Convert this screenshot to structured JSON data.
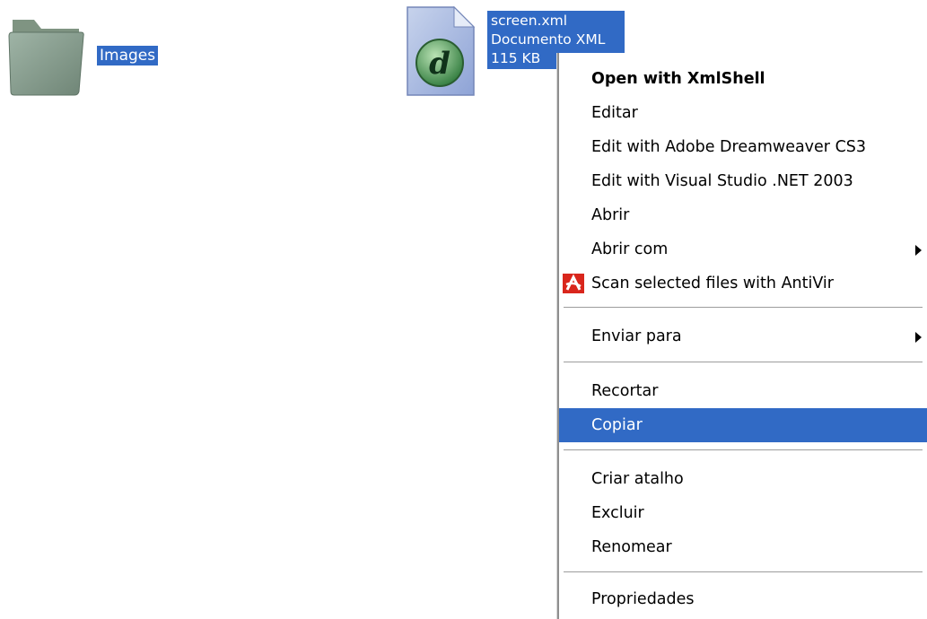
{
  "folder": {
    "name": "Images",
    "icon": "folder-icon"
  },
  "file": {
    "name": "screen.xml",
    "type": "Documento XML",
    "size": "115 KB",
    "icon": "dreamweaver-xml-file-icon"
  },
  "context_menu": {
    "items": [
      {
        "label": "Open with XmlShell"
      },
      {
        "label": "Editar"
      },
      {
        "label": "Edit with Adobe Dreamweaver CS3"
      },
      {
        "label": "Edit with Visual Studio .NET 2003"
      },
      {
        "label": "Abrir"
      },
      {
        "label": "Abrir com"
      },
      {
        "label": "Scan selected files with AntiVir",
        "icon": "antivir-icon"
      },
      {
        "label": "Enviar para"
      },
      {
        "label": "Recortar"
      },
      {
        "label": "Copiar"
      },
      {
        "label": "Criar atalho"
      },
      {
        "label": "Excluir"
      },
      {
        "label": "Renomear"
      },
      {
        "label": "Propriedades"
      }
    ]
  },
  "colors": {
    "selection": "#316ac5",
    "antivir_red": "#d9261c",
    "dreamweaver_green": "#3e8f4a"
  }
}
